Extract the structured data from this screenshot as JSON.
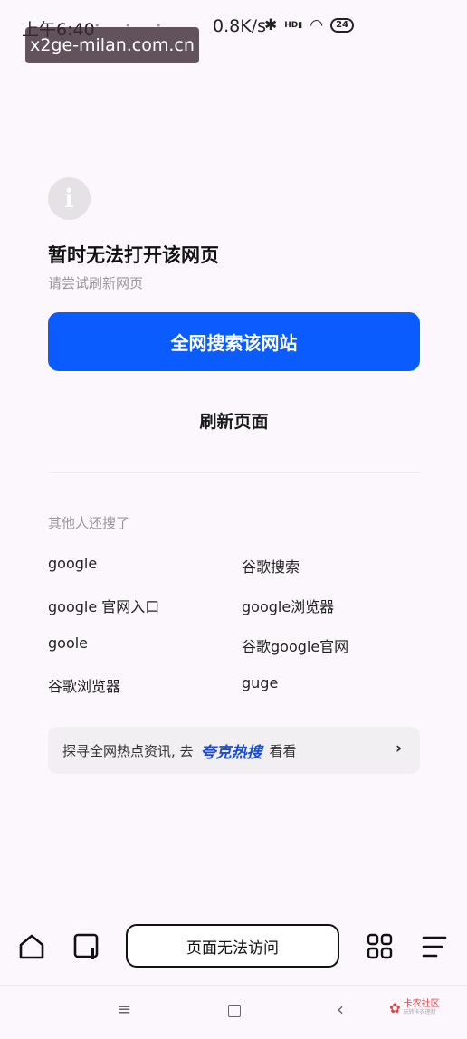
{
  "status_bar": {
    "time": "上午6:40",
    "speed": "0.8K/s",
    "network_badge": "HD",
    "battery": "24"
  },
  "watermark": "x2ge-milan.com.cn",
  "error": {
    "title": "暂时无法打开该网页",
    "subtitle": "请尝试刷新网页",
    "search_button": "全网搜索该网站",
    "refresh_button": "刷新页面"
  },
  "others": {
    "title": "其他人还搜了",
    "items": [
      "google",
      "谷歌搜索",
      "google 官网入口",
      "google浏览器",
      "goole",
      "谷歌google官网",
      "谷歌浏览器",
      "guge"
    ]
  },
  "hot": {
    "prefix": "探寻全网热点资讯, 去",
    "brand": "夸克热搜",
    "suffix": "看看",
    "arrow": "›"
  },
  "toolbar": {
    "address_text": "页面无法访问",
    "icons": [
      "home-icon",
      "tabs-icon",
      "apps-icon",
      "menu-icon"
    ]
  },
  "nav_bar": {
    "menu_glyph": "≡",
    "back_glyph": "‹",
    "badge_title": "卡农社区",
    "badge_sub": "玩转卡农理财"
  },
  "colors": {
    "accent": "#0a5cff",
    "background": "#fbf7fc"
  }
}
